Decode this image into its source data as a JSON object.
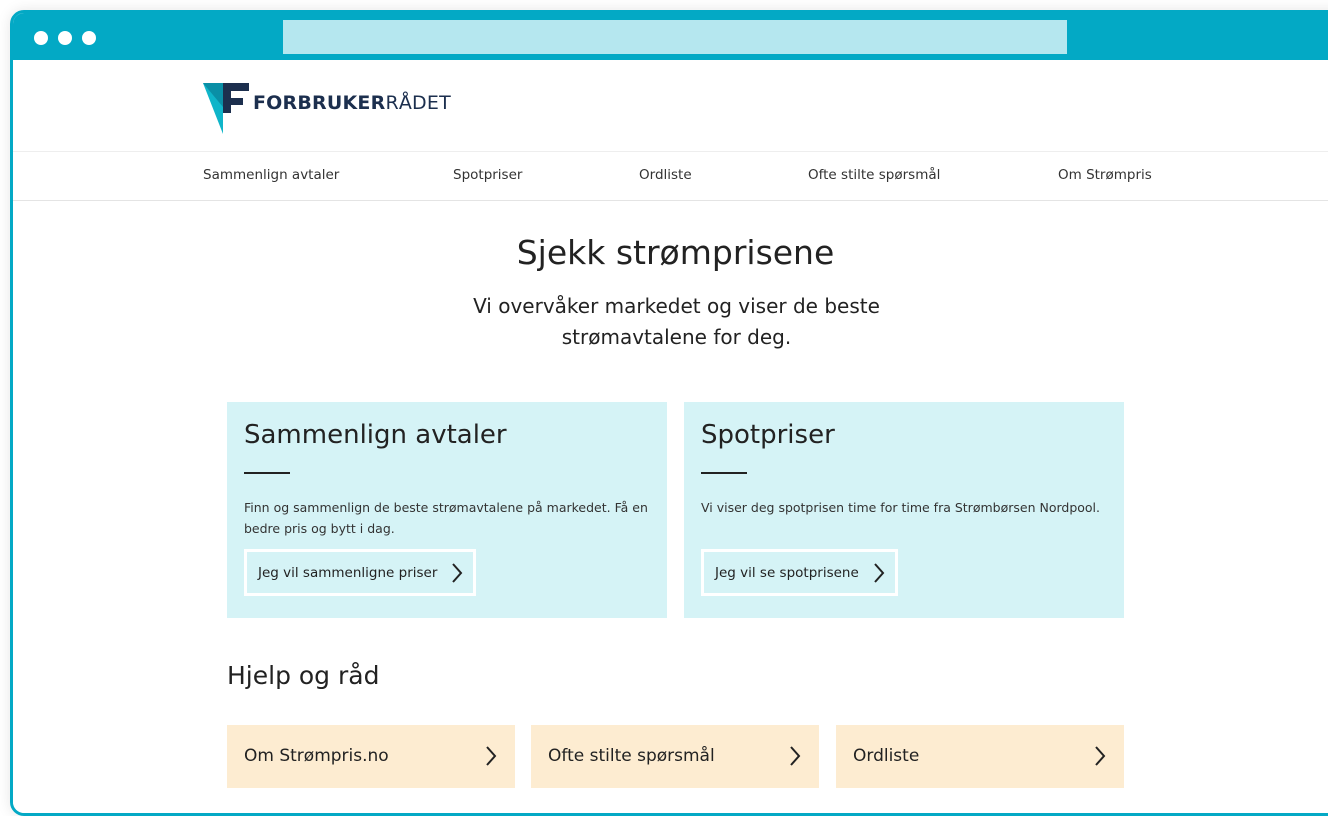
{
  "brand": {
    "logo_bold": "FORBRUKER",
    "logo_light": "RÅDET",
    "colors": {
      "accent": "#03a9c5",
      "url_bar": "#b5e7ef",
      "logo_mark": "#0fb5c9",
      "logo_text": "#1c2f4e",
      "card_blue": "#d5f3f6",
      "card_peach": "#fdecd1"
    }
  },
  "nav": {
    "items": [
      {
        "label": "Sammenlign avtaler"
      },
      {
        "label": "Spotpriser"
      },
      {
        "label": "Ordliste"
      },
      {
        "label": "Ofte stilte spørsmål"
      },
      {
        "label": "Om Strømpris"
      }
    ]
  },
  "hero": {
    "title": "Sjekk strømprisene",
    "subtitle": "Vi overvåker markedet og viser de beste strømavtalene for deg."
  },
  "cards": [
    {
      "title": "Sammenlign avtaler",
      "text": "Finn og sammenlign de beste strømavtalene på markedet. Få en bedre pris og bytt i dag.",
      "button_label": "Jeg vil sammenligne priser",
      "button_icon": "chevron-right-icon"
    },
    {
      "title": "Spotpriser",
      "text": "Vi viser deg spotprisen time for time fra Strømbørsen Nordpool.",
      "button_label": "Jeg vil se spotprisene",
      "button_icon": "chevron-right-icon"
    }
  ],
  "help": {
    "title": "Hjelp og råd",
    "items": [
      {
        "label": "Om Strømpris.no",
        "icon": "chevron-right-icon"
      },
      {
        "label": "Ofte stilte spørsmål",
        "icon": "chevron-right-icon"
      },
      {
        "label": "Ordliste",
        "icon": "chevron-right-icon"
      }
    ]
  }
}
